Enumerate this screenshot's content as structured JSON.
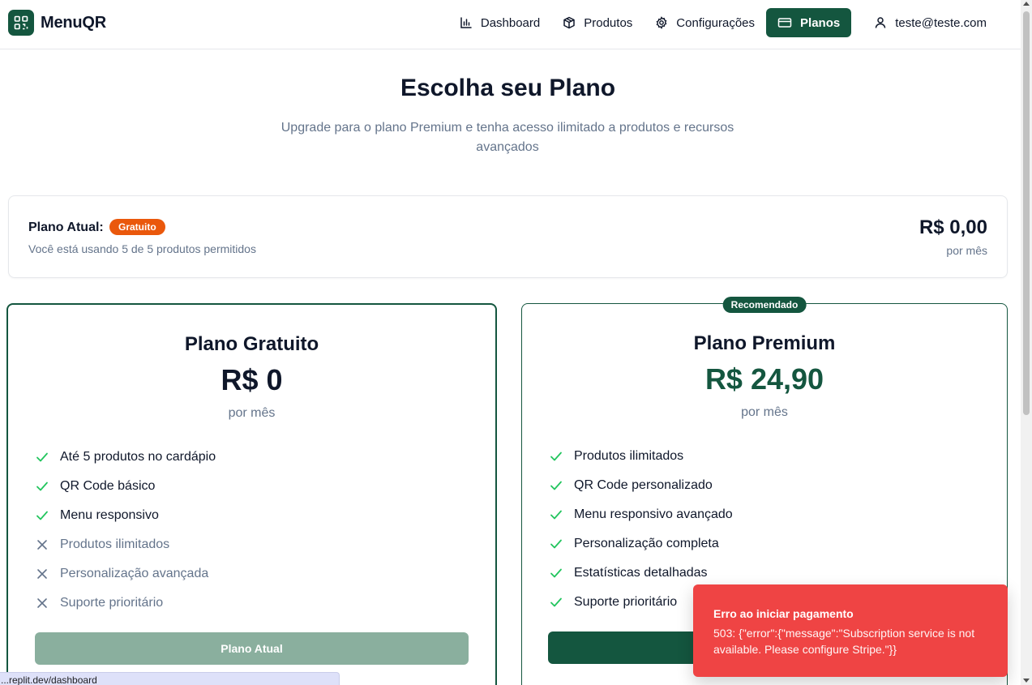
{
  "header": {
    "brand": "MenuQR",
    "nav": [
      {
        "label": "Dashboard",
        "icon": "bar-chart-icon"
      },
      {
        "label": "Produtos",
        "icon": "package-icon"
      },
      {
        "label": "Configurações",
        "icon": "gear-icon"
      },
      {
        "label": "Planos",
        "icon": "credit-card-icon",
        "active": true
      }
    ],
    "user_email": "teste@teste.com"
  },
  "hero": {
    "title": "Escolha seu Plano",
    "subtitle": "Upgrade para o plano Premium e tenha acesso ilimitado a produtos e recursos avançados"
  },
  "current_plan": {
    "label": "Plano Atual:",
    "badge": "Gratuito",
    "usage": "Você está usando 5 de 5 produtos permitidos",
    "price": "R$ 0,00",
    "period": "por mês"
  },
  "plans": {
    "free": {
      "title": "Plano Gratuito",
      "price": "R$ 0",
      "period": "por mês",
      "features": [
        {
          "text": "Até 5 produtos no cardápio",
          "included": true
        },
        {
          "text": "QR Code básico",
          "included": true
        },
        {
          "text": "Menu responsivo",
          "included": true
        },
        {
          "text": "Produtos ilimitados",
          "included": false
        },
        {
          "text": "Personalização avançada",
          "included": false
        },
        {
          "text": "Suporte prioritário",
          "included": false
        }
      ],
      "button": "Plano Atual"
    },
    "premium": {
      "badge": "Recomendado",
      "title": "Plano Premium",
      "price": "R$ 24,90",
      "period": "por mês",
      "features": [
        {
          "text": "Produtos ilimitados",
          "included": true
        },
        {
          "text": "QR Code personalizado",
          "included": true
        },
        {
          "text": "Menu responsivo avançado",
          "included": true
        },
        {
          "text": "Personalização completa",
          "included": true
        },
        {
          "text": "Estatísticas detalhadas",
          "included": true
        },
        {
          "text": "Suporte prioritário",
          "included": true
        }
      ],
      "button": ""
    }
  },
  "toast": {
    "title": "Erro ao iniciar pagamento",
    "message": "503: {\"error\":{\"message\":\"Subscription service is not available. Please configure Stripe.\"}}"
  },
  "status_bar": {
    "url": "...replit.dev/dashboard"
  },
  "colors": {
    "brand": "#14563f",
    "badge_free": "#ea580c",
    "check": "#22c55e",
    "toast_error": "#ef4444"
  }
}
